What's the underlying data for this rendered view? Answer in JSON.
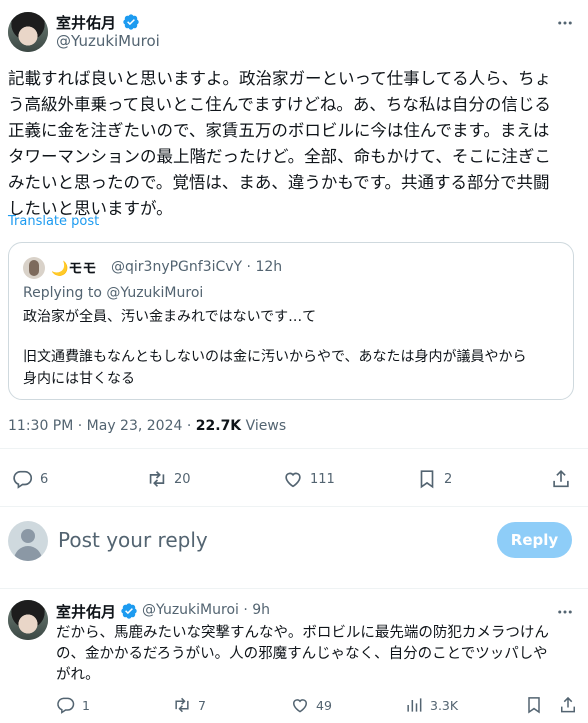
{
  "tweet": {
    "author_name": "室井佑月",
    "author_handle": "@YuzukiMuroi",
    "text_lines": [
      "記載すれば良いと思いますよ。政治家ガーといって仕事してる人ら、ちょ",
      "う高級外車乗って良いとこ住んでますけどね。あ、ちな私は自分の信じる",
      "正義に金を注ぎたいので、家賃五万のボロビルに今は住んでます。まえは",
      "タワーマンションの最上階だったけど。全部、命もかけて、そこに注ぎこ",
      "みたいと思ったので。覚悟は、まあ、違うかもです。共通する部分で共闘",
      "したいと思いますが。"
    ],
    "translate_label": "Translate post",
    "time": "11:30 PM · May 23, 2024 · ",
    "views_count": "22.7K",
    "views_label": " Views",
    "stats": {
      "replies": "6",
      "reposts": "20",
      "likes": "111",
      "bookmarks": "2"
    }
  },
  "quote": {
    "name": "🌙モモ",
    "handle": "@qir3nyPGnf3iCvY · 12h",
    "replying_to": "Replying to @YuzukiMuroi",
    "line1": "政治家が全員、汚い金まみれではないです…て",
    "line2": "旧文通費誰もなんともしないのは金に汚いからやで、あなたは身内が議員やから",
    "line3": "身内には甘くなる"
  },
  "reply_box": {
    "placeholder": "Post your reply",
    "button": "Reply"
  },
  "reply": {
    "author_name": "室井佑月",
    "author_handle": "@YuzukiMuroi · 9h",
    "text_lines": [
      "だから、馬鹿みたいな突撃すんなや。ボロビルに最先端の防犯カメラつけん",
      "の、金かかるだろうがい。人の邪魔すんじゃなく、自分のことでツッパしや",
      "がれ。"
    ],
    "stats": {
      "replies": "1",
      "reposts": "7",
      "likes": "49",
      "views": "3.3K"
    }
  },
  "colors": {
    "accent": "#1d9bf0",
    "muted": "#536471",
    "verified": "#1d9bf0"
  }
}
